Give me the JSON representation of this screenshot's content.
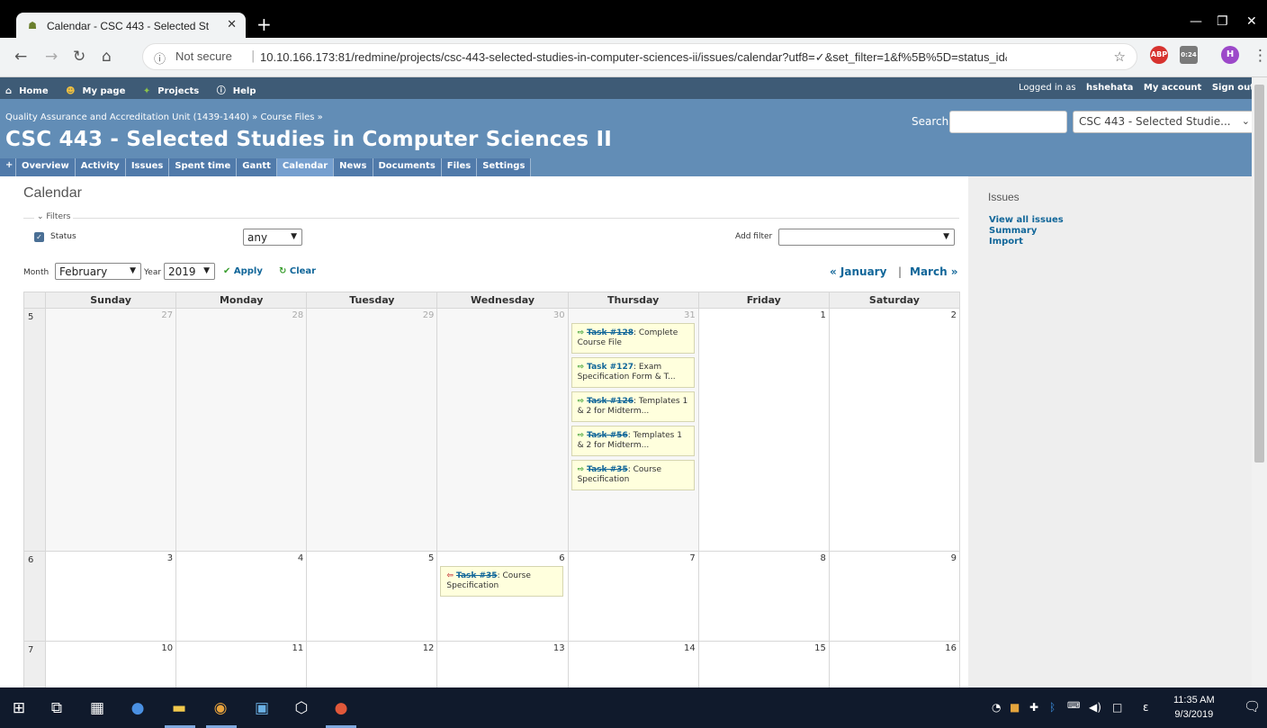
{
  "browser": {
    "tab_title": "Calendar - CSC 443 - Selected St",
    "url_prefix": "Not secure",
    "url": "10.10.166.173:81/redmine/projects/csc-443-selected-studies-in-computer-sciences-ii/issues/calendar?utf8=✓&set_filter=1&f%5B%5D=status_id&...",
    "ext_badge": "0:24",
    "profile_initial": "H"
  },
  "top_menu": {
    "home": "Home",
    "my_page": "My page",
    "projects": "Projects",
    "help": "Help",
    "logged_in_prefix": "Logged in as",
    "user": "hshehata",
    "my_account": "My account",
    "sign_out": "Sign out"
  },
  "header": {
    "breadcrumb": "Quality Assurance and Accreditation Unit (1439-1440) » Course Files »",
    "title": "CSC 443 - Selected Studies in Computer Sciences II",
    "search_label": "Search:",
    "project_jump": "CSC 443 - Selected Studie..."
  },
  "main_menu": {
    "plus": "+",
    "tabs": [
      "Overview",
      "Activity",
      "Issues",
      "Spent time",
      "Gantt",
      "Calendar",
      "News",
      "Documents",
      "Files",
      "Settings"
    ],
    "selected": "Calendar"
  },
  "content": {
    "heading": "Calendar",
    "filters_legend": "Filters",
    "status_label": "Status",
    "status_operator": "any",
    "add_filter_label": "Add filter",
    "month_label": "Month",
    "month_value": "February",
    "year_label": "Year",
    "year_value": "2019",
    "apply": "Apply",
    "clear": "Clear",
    "prev_month": "« January",
    "separator": "|",
    "next_month": "March »"
  },
  "calendar": {
    "weekdays": [
      "Sunday",
      "Monday",
      "Tuesday",
      "Wednesday",
      "Thursday",
      "Friday",
      "Saturday"
    ],
    "weeks": [
      {
        "week": "5",
        "days": [
          {
            "day": "27",
            "other": true,
            "issues": []
          },
          {
            "day": "28",
            "other": true,
            "issues": []
          },
          {
            "day": "29",
            "other": true,
            "issues": []
          },
          {
            "day": "30",
            "other": true,
            "issues": []
          },
          {
            "day": "31",
            "other": true,
            "issues": [
              {
                "link": "Task #128",
                "text": ": Complete Course File",
                "closed": true,
                "marker": "start"
              },
              {
                "link": "Task #127",
                "text": ": Exam Specification Form & T...",
                "closed": false,
                "marker": "start"
              },
              {
                "link": "Task #126",
                "text": ": Templates 1 & 2 for Midterm...",
                "closed": true,
                "marker": "start"
              },
              {
                "link": "Task #56",
                "text": ": Templates 1 & 2 for Midterm...",
                "closed": true,
                "marker": "start"
              },
              {
                "link": "Task #35",
                "text": ": Course Specification",
                "closed": true,
                "marker": "start"
              }
            ]
          },
          {
            "day": "1",
            "other": false,
            "issues": []
          },
          {
            "day": "2",
            "other": false,
            "issues": []
          }
        ]
      },
      {
        "week": "6",
        "days": [
          {
            "day": "3",
            "other": false,
            "issues": []
          },
          {
            "day": "4",
            "other": false,
            "issues": []
          },
          {
            "day": "5",
            "other": false,
            "issues": []
          },
          {
            "day": "6",
            "other": false,
            "issues": [
              {
                "link": "Task #35",
                "text": ": Course Specification",
                "closed": true,
                "marker": "end"
              }
            ]
          },
          {
            "day": "7",
            "other": false,
            "issues": []
          },
          {
            "day": "8",
            "other": false,
            "issues": []
          },
          {
            "day": "9",
            "other": false,
            "issues": []
          }
        ]
      },
      {
        "week": "7",
        "days": [
          {
            "day": "10",
            "other": false,
            "issues": []
          },
          {
            "day": "11",
            "other": false,
            "issues": []
          },
          {
            "day": "12",
            "other": false,
            "issues": []
          },
          {
            "day": "13",
            "other": false,
            "issues": []
          },
          {
            "day": "14",
            "other": false,
            "issues": []
          },
          {
            "day": "15",
            "other": false,
            "issues": []
          },
          {
            "day": "16",
            "other": false,
            "issues": []
          }
        ]
      }
    ]
  },
  "sidebar": {
    "title": "Issues",
    "links": [
      "View all issues",
      "Summary",
      "Import"
    ]
  },
  "taskbar": {
    "time": "11:35 AM",
    "date": "9/3/2019"
  },
  "colors": {
    "top_menu": "#3e5b76",
    "header": "#628db6",
    "link": "#169",
    "issue_bg": "#ffffdd"
  }
}
